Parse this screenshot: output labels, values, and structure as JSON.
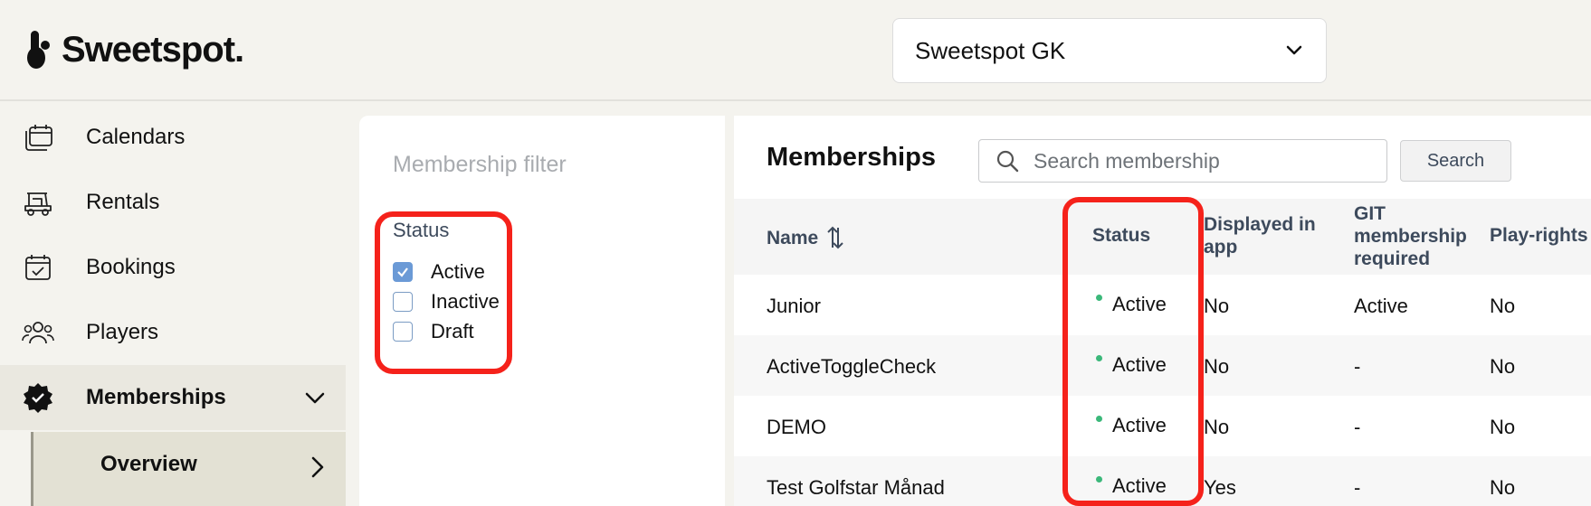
{
  "header": {
    "logo_text": "Sweetspot.",
    "club_select_value": "Sweetspot GK"
  },
  "sidebar": {
    "items": [
      {
        "label": "Calendars",
        "icon": "calendar-stack-icon"
      },
      {
        "label": "Rentals",
        "icon": "golf-cart-icon"
      },
      {
        "label": "Bookings",
        "icon": "calendar-check-icon"
      },
      {
        "label": "Players",
        "icon": "users-icon"
      },
      {
        "label": "Memberships",
        "icon": "badge-check-icon"
      }
    ],
    "sub_item": {
      "label": "Overview"
    }
  },
  "filter": {
    "title": "Membership filter",
    "status_label": "Status",
    "options": [
      {
        "label": "Active",
        "checked": true
      },
      {
        "label": "Inactive",
        "checked": false
      },
      {
        "label": "Draft",
        "checked": false
      }
    ]
  },
  "memberships": {
    "title": "Memberships",
    "search_placeholder": "Search membership",
    "search_button": "Search",
    "columns": {
      "name": "Name",
      "status": "Status",
      "displayed_line1": "Displayed in",
      "displayed_line2": "app",
      "git_line1": "GIT",
      "git_line2": "membership",
      "git_line3": "required",
      "play_rights": "Play-rights"
    },
    "rows": [
      {
        "name": "Junior",
        "status": "Active",
        "displayed": "No",
        "git": "Active",
        "play_rights": "No"
      },
      {
        "name": "ActiveToggleCheck",
        "status": "Active",
        "displayed": "No",
        "git": "-",
        "play_rights": "No"
      },
      {
        "name": "DEMO",
        "status": "Active",
        "displayed": "No",
        "git": "-",
        "play_rights": "No"
      },
      {
        "name": "Test Golfstar Månad",
        "status": "Active",
        "displayed": "Yes",
        "git": "-",
        "play_rights": "No"
      }
    ]
  },
  "colors": {
    "highlight": "#f5221b",
    "status_dot": "#3bb87a",
    "checkbox": "#6b9ad6"
  }
}
